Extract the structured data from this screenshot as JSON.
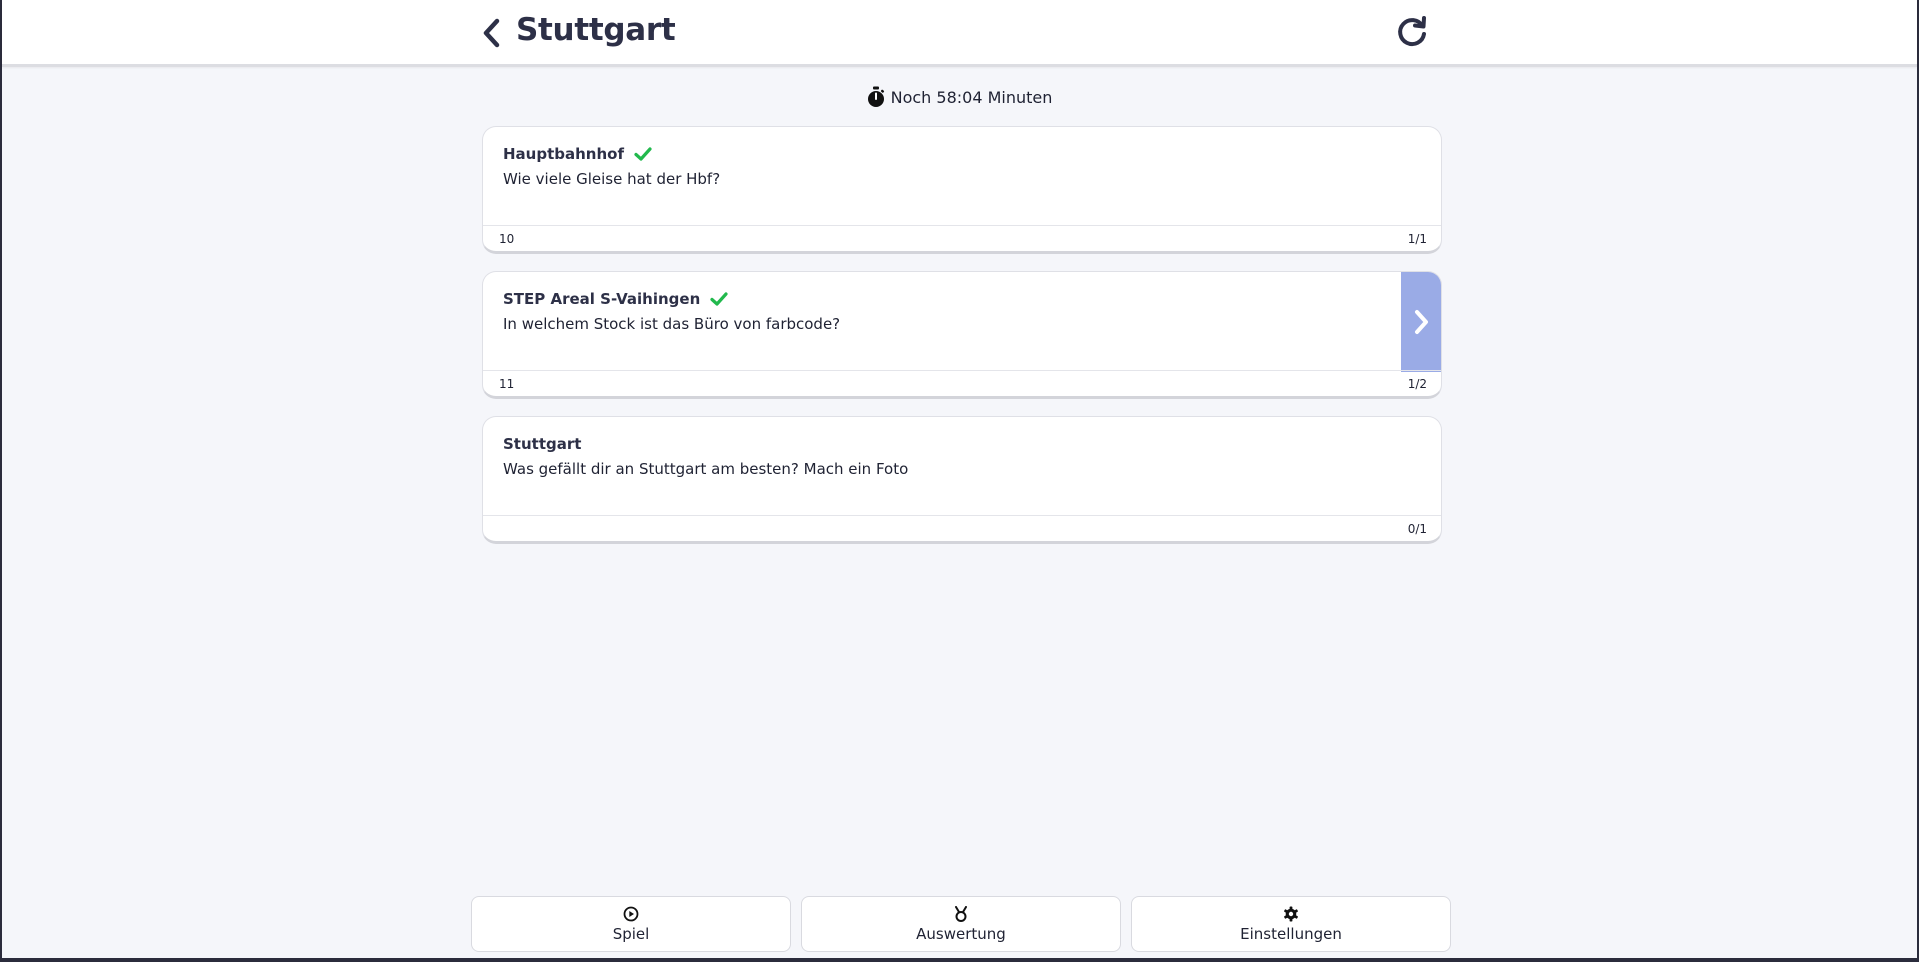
{
  "header": {
    "title": "Stuttgart",
    "back_icon": "chevron-left-icon",
    "refresh_icon": "refresh-icon"
  },
  "timer": {
    "icon": "stopwatch-icon",
    "text": "Noch 58:04 Minuten"
  },
  "cards": [
    {
      "title": "Hauptbahnhof",
      "completed": true,
      "question": "Wie viele Gleise hat der Hbf?",
      "footer_left": "10",
      "footer_right": "1/1",
      "has_next": false
    },
    {
      "title": "STEP Areal S-Vaihingen",
      "completed": true,
      "question": "In welchem Stock ist das Büro von farbcode?",
      "footer_left": "11",
      "footer_right": "1/2",
      "has_next": true
    },
    {
      "title": "Stuttgart",
      "completed": false,
      "question": "Was gefällt dir an Stuttgart am besten? Mach ein Foto",
      "footer_left": "",
      "footer_right": "0/1",
      "has_next": false
    }
  ],
  "bottom_nav": [
    {
      "label": "Spiel",
      "icon": "play-circle-icon"
    },
    {
      "label": "Auswertung",
      "icon": "medal-icon"
    },
    {
      "label": "Einstellungen",
      "icon": "gear-icon"
    }
  ],
  "colors": {
    "accent_next": "#9aabe6",
    "check_green": "#22b94d",
    "title_dark": "#2d3047",
    "background": "#f5f6fa"
  }
}
